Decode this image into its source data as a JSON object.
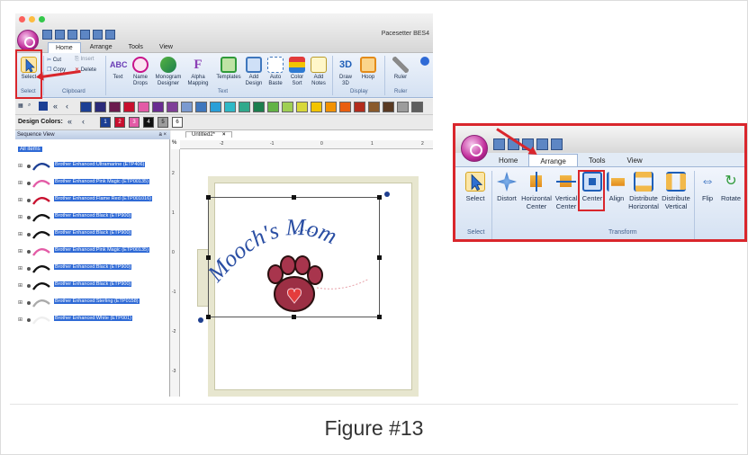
{
  "figure": {
    "caption": "Figure #13"
  },
  "app": {
    "title": "Pacesetter BES4",
    "tabs": [
      "Home",
      "Arrange",
      "Tools",
      "View"
    ],
    "active_tab": "Home"
  },
  "ribbon": {
    "select_label": "Select",
    "clipboard": {
      "cut": "Cut",
      "copy": "Copy",
      "insert": "Insert",
      "delete": "Delete"
    },
    "text_buttons": [
      "Text",
      "Name Drops",
      "Monogram Designer",
      "Alpha Mapping"
    ],
    "misc_buttons": [
      "Templates",
      "Add Design",
      "Auto Baste",
      "Color Sort",
      "Add Notes"
    ],
    "display_buttons": [
      "Draw 3D",
      "Hoop"
    ],
    "ruler_label": "Ruler",
    "groups": [
      "Select",
      "Clipboard",
      "Text",
      "Display",
      "Ruler"
    ],
    "badge_3d": "3D"
  },
  "palette": {
    "nav": "«",
    "prev": "‹",
    "design_colors_label": "Design Colors:",
    "design_colors": [
      "1",
      "2",
      "3",
      "4",
      "5",
      "6"
    ],
    "swatch_colors": [
      "#1c3f94",
      "#2b2b7a",
      "#6b1b4d",
      "#c8102e",
      "#e35ba6",
      "#6a2c91",
      "#7f3f98",
      "#7b9ad0",
      "#3f77bd",
      "#2a9fd8",
      "#2fb9c7",
      "#31a98c",
      "#1c7e4e",
      "#63b346",
      "#9fcf54",
      "#d8d83a",
      "#f2c400",
      "#f39200",
      "#e95e0f",
      "#b22c1c",
      "#8a5a2b",
      "#5a3a22",
      "#9c9c9c",
      "#5e5e5e"
    ]
  },
  "sequence_view": {
    "title": "Sequence View",
    "controls": "a ×",
    "all_items": "All items",
    "items": [
      "Brother Enhanced:Ultramarine (ETP406)",
      "Brother Enhanced:Pink Magic (ETP00135)",
      "Brother Enhanced:Flame Red (ETP001016)",
      "Brother Enhanced:Black (ETP900)",
      "Brother Enhanced:Black (ETP900)",
      "Brother Enhanced:Pink Magic (ETP00135)",
      "Brother Enhanced:Black (ETP900)",
      "Brother Enhanced:Black (ETP900)",
      "Brother Enhanced:Sterling (ETP0158)",
      "Brother Enhanced:White (ETP001)"
    ]
  },
  "document": {
    "tab": "Untitled2*",
    "close": "×",
    "corner": "%",
    "ruler_top": [
      "-2",
      "-1",
      "0",
      "1",
      "2"
    ],
    "ruler_left": [
      "2",
      "1",
      "0",
      "-1",
      "-2",
      "-3"
    ],
    "design_text": "Mooch's Mom"
  },
  "inset": {
    "tabs": [
      "Home",
      "Arrange",
      "Tools",
      "View"
    ],
    "active_tab": "Arrange",
    "buttons": [
      "Select",
      "Distort",
      "Horizontal Center",
      "Vertical Center",
      "Center",
      "Align",
      "Distribute Horizontal",
      "Distribute Vertical",
      "Flip",
      "Rotate"
    ],
    "groups": [
      "Select",
      "Transform"
    ]
  },
  "colors": {
    "highlight": "#d9262c",
    "selection": "#2f6ad6",
    "ribbon": "#d4e1f2"
  }
}
